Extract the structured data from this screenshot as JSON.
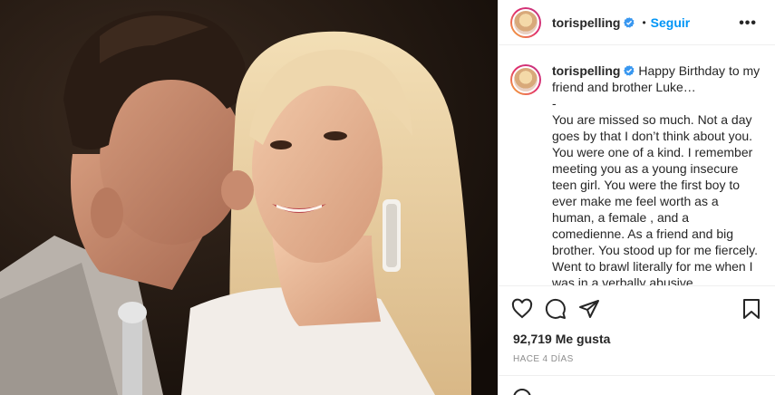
{
  "header": {
    "username": "torispelling",
    "separator": "•",
    "follow_label": "Seguir",
    "more_label": "•••"
  },
  "caption": {
    "username": "torispelling",
    "text": "Happy Birthday to my friend and brother Luke…\n-\nYou are missed so much. Not a day goes by that I don’t think about you. You were one of a kind. I remember meeting you as a young insecure teen girl. You were the first boy to ever make me feel worth as a human, a female , and a comedienne. As a friend and big brother. You stood up for me fiercely. Went to brawl literally for me when I was in a verbally abusive relationship and sat and talked me thru the next in my some sort of a..."
  },
  "actions": {
    "icons": [
      "heart-icon",
      "comment-icon",
      "share-icon",
      "bookmark-icon"
    ]
  },
  "likes": {
    "count": "92,719",
    "label": "Me gusta"
  },
  "timestamp": "HACE 4 DÍAS",
  "colors": {
    "link_blue": "#0095f6",
    "verified_blue": "#3897f0",
    "text": "#262626",
    "muted": "#8e8e8e"
  }
}
